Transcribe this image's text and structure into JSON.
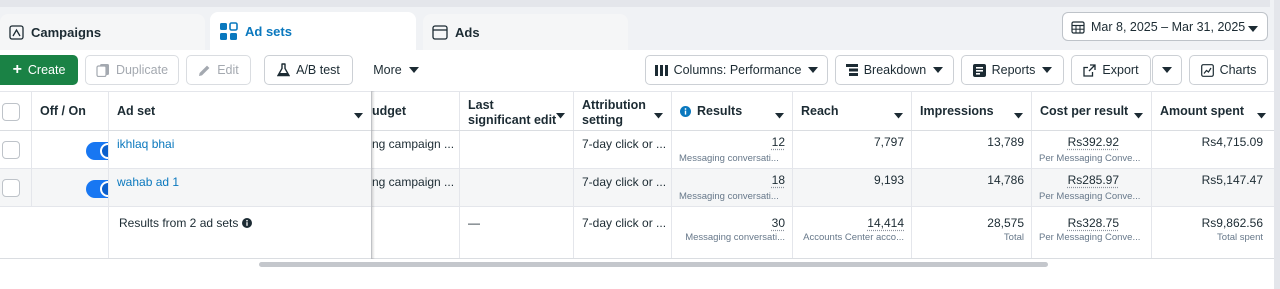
{
  "tabs": {
    "campaigns": "Campaigns",
    "adsets": "Ad sets",
    "ads": "Ads"
  },
  "date_range": "Mar 8, 2025 – Mar 31, 2025",
  "toolbar": {
    "create": "Create",
    "duplicate": "Duplicate",
    "edit": "Edit",
    "ab_test": "A/B test",
    "more": "More",
    "columns": "Columns: Performance",
    "breakdown": "Breakdown",
    "reports": "Reports",
    "export": "Export",
    "charts": "Charts"
  },
  "columns": {
    "off_on": "Off / On",
    "ad_set": "Ad set",
    "budget": "udget",
    "last_edit": "Last significant edit",
    "attribution": "Attribution setting",
    "results": "Results",
    "reach": "Reach",
    "impressions": "Impressions",
    "cost_per_result": "Cost per result",
    "amount_spent": "Amount spent"
  },
  "rows": [
    {
      "name": "ikhlaq bhai",
      "budget": "Using campaign ...",
      "budget_visible": "ng campaign ...",
      "last_edit": "",
      "attribution": "7-day click or ...",
      "results": "12",
      "results_sub": "Messaging conversati...",
      "reach": "7,797",
      "impressions": "13,789",
      "cost_per_result": "Rs392.92",
      "cost_sub": "Per Messaging Conve...",
      "amount_spent": "Rs4,715.09"
    },
    {
      "name": "wahab ad 1",
      "budget": "Using campaign ...",
      "budget_visible": "ng campaign ...",
      "last_edit": "",
      "attribution": "7-day click or ...",
      "results": "18",
      "results_sub": "Messaging conversati...",
      "reach": "9,193",
      "impressions": "14,786",
      "cost_per_result": "Rs285.97",
      "cost_sub": "Per Messaging Conve...",
      "amount_spent": "Rs5,147.47"
    }
  ],
  "totals": {
    "label": "Results from 2 ad sets",
    "last_edit": "—",
    "attribution": "7-day click or ...",
    "results": "30",
    "results_sub": "Messaging conversati...",
    "reach": "14,414",
    "reach_sub": "Accounts Center acco...",
    "impressions": "28,575",
    "impressions_sub": "Total",
    "cost_per_result": "Rs328.75",
    "cost_sub": "Per Messaging Conve...",
    "amount_spent": "Rs9,862.56",
    "amount_sub": "Total spent"
  },
  "icons": {
    "campaigns": "campaign-folder-icon",
    "adsets": "adsets-grid-icon",
    "ads": "ad-window-icon",
    "date": "calendar-icon"
  },
  "colors": {
    "accent_blue": "#0a78be",
    "create_green": "#1a8245",
    "toggle_on": "#1877f2"
  }
}
